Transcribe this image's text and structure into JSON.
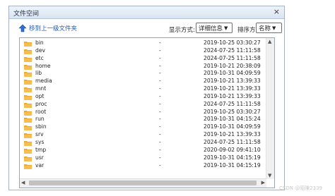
{
  "dialog": {
    "title": "文件空间",
    "close_label": "×"
  },
  "toolbar": {
    "up_label": "移到上一级文件夹",
    "show_label": "显示方式:",
    "show_value": "详细信息",
    "sort_label": "排序方式:",
    "sort_value": "名称"
  },
  "files": [
    {
      "name": "bin",
      "size": "-",
      "date": "2019-10-25 03:30:27"
    },
    {
      "name": "dev",
      "size": "-",
      "date": "2024-07-25 11:11:58"
    },
    {
      "name": "etc",
      "size": "-",
      "date": "2024-07-25 11:11:58"
    },
    {
      "name": "home",
      "size": "-",
      "date": "2019-10-21 20:38:09"
    },
    {
      "name": "lib",
      "size": "-",
      "date": "2019-10-31 04:09:59"
    },
    {
      "name": "media",
      "size": "-",
      "date": "2019-10-21 13:39:33"
    },
    {
      "name": "mnt",
      "size": "-",
      "date": "2019-10-21 13:39:33"
    },
    {
      "name": "opt",
      "size": "-",
      "date": "2019-10-21 13:39:33"
    },
    {
      "name": "proc",
      "size": "-",
      "date": "2024-07-25 11:11:58"
    },
    {
      "name": "root",
      "size": "-",
      "date": "2019-10-25 03:30:27"
    },
    {
      "name": "run",
      "size": "-",
      "date": "2019-10-31 04:15:24"
    },
    {
      "name": "sbin",
      "size": "-",
      "date": "2019-10-31 04:09:59"
    },
    {
      "name": "srv",
      "size": "-",
      "date": "2019-10-21 13:39:33"
    },
    {
      "name": "sys",
      "size": "-",
      "date": "2024-07-25 11:11:58"
    },
    {
      "name": "tmp",
      "size": "-",
      "date": "2020-09-02 09:41:10"
    },
    {
      "name": "usr",
      "size": "-",
      "date": "2019-10-31 04:15:19"
    },
    {
      "name": "var",
      "size": "-",
      "date": "2019-10-31 04:15:19"
    }
  ],
  "icons": {
    "folder": "folder-icon",
    "up": "up-arrow-icon",
    "close": "close-icon"
  },
  "colors": {
    "folder": "#f0a830",
    "link": "#245bb0",
    "titlebar": "#dde7f3"
  },
  "watermark": "CSDN @陌陳2339"
}
